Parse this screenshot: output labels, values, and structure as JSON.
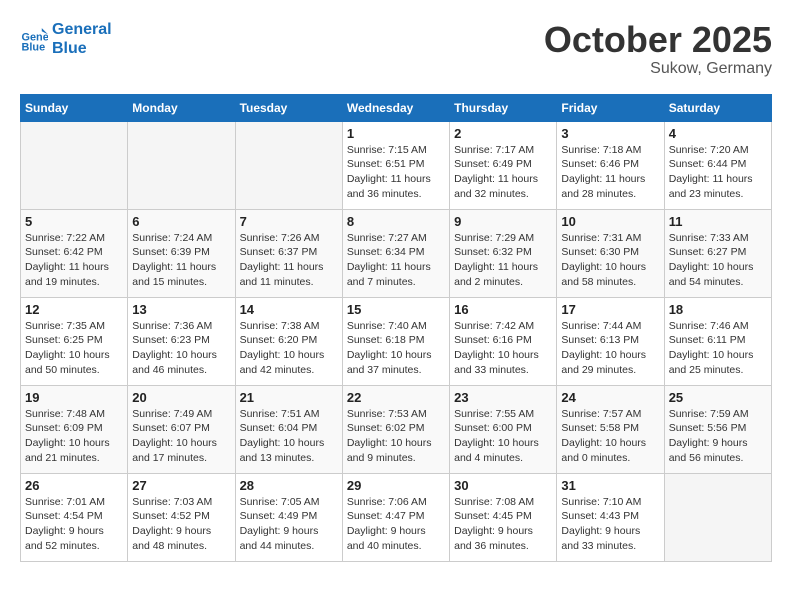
{
  "header": {
    "logo_line1": "General",
    "logo_line2": "Blue",
    "month": "October 2025",
    "location": "Sukow, Germany"
  },
  "weekdays": [
    "Sunday",
    "Monday",
    "Tuesday",
    "Wednesday",
    "Thursday",
    "Friday",
    "Saturday"
  ],
  "weeks": [
    [
      {
        "day": "",
        "info": ""
      },
      {
        "day": "",
        "info": ""
      },
      {
        "day": "",
        "info": ""
      },
      {
        "day": "1",
        "info": "Sunrise: 7:15 AM\nSunset: 6:51 PM\nDaylight: 11 hours\nand 36 minutes."
      },
      {
        "day": "2",
        "info": "Sunrise: 7:17 AM\nSunset: 6:49 PM\nDaylight: 11 hours\nand 32 minutes."
      },
      {
        "day": "3",
        "info": "Sunrise: 7:18 AM\nSunset: 6:46 PM\nDaylight: 11 hours\nand 28 minutes."
      },
      {
        "day": "4",
        "info": "Sunrise: 7:20 AM\nSunset: 6:44 PM\nDaylight: 11 hours\nand 23 minutes."
      }
    ],
    [
      {
        "day": "5",
        "info": "Sunrise: 7:22 AM\nSunset: 6:42 PM\nDaylight: 11 hours\nand 19 minutes."
      },
      {
        "day": "6",
        "info": "Sunrise: 7:24 AM\nSunset: 6:39 PM\nDaylight: 11 hours\nand 15 minutes."
      },
      {
        "day": "7",
        "info": "Sunrise: 7:26 AM\nSunset: 6:37 PM\nDaylight: 11 hours\nand 11 minutes."
      },
      {
        "day": "8",
        "info": "Sunrise: 7:27 AM\nSunset: 6:34 PM\nDaylight: 11 hours\nand 7 minutes."
      },
      {
        "day": "9",
        "info": "Sunrise: 7:29 AM\nSunset: 6:32 PM\nDaylight: 11 hours\nand 2 minutes."
      },
      {
        "day": "10",
        "info": "Sunrise: 7:31 AM\nSunset: 6:30 PM\nDaylight: 10 hours\nand 58 minutes."
      },
      {
        "day": "11",
        "info": "Sunrise: 7:33 AM\nSunset: 6:27 PM\nDaylight: 10 hours\nand 54 minutes."
      }
    ],
    [
      {
        "day": "12",
        "info": "Sunrise: 7:35 AM\nSunset: 6:25 PM\nDaylight: 10 hours\nand 50 minutes."
      },
      {
        "day": "13",
        "info": "Sunrise: 7:36 AM\nSunset: 6:23 PM\nDaylight: 10 hours\nand 46 minutes."
      },
      {
        "day": "14",
        "info": "Sunrise: 7:38 AM\nSunset: 6:20 PM\nDaylight: 10 hours\nand 42 minutes."
      },
      {
        "day": "15",
        "info": "Sunrise: 7:40 AM\nSunset: 6:18 PM\nDaylight: 10 hours\nand 37 minutes."
      },
      {
        "day": "16",
        "info": "Sunrise: 7:42 AM\nSunset: 6:16 PM\nDaylight: 10 hours\nand 33 minutes."
      },
      {
        "day": "17",
        "info": "Sunrise: 7:44 AM\nSunset: 6:13 PM\nDaylight: 10 hours\nand 29 minutes."
      },
      {
        "day": "18",
        "info": "Sunrise: 7:46 AM\nSunset: 6:11 PM\nDaylight: 10 hours\nand 25 minutes."
      }
    ],
    [
      {
        "day": "19",
        "info": "Sunrise: 7:48 AM\nSunset: 6:09 PM\nDaylight: 10 hours\nand 21 minutes."
      },
      {
        "day": "20",
        "info": "Sunrise: 7:49 AM\nSunset: 6:07 PM\nDaylight: 10 hours\nand 17 minutes."
      },
      {
        "day": "21",
        "info": "Sunrise: 7:51 AM\nSunset: 6:04 PM\nDaylight: 10 hours\nand 13 minutes."
      },
      {
        "day": "22",
        "info": "Sunrise: 7:53 AM\nSunset: 6:02 PM\nDaylight: 10 hours\nand 9 minutes."
      },
      {
        "day": "23",
        "info": "Sunrise: 7:55 AM\nSunset: 6:00 PM\nDaylight: 10 hours\nand 4 minutes."
      },
      {
        "day": "24",
        "info": "Sunrise: 7:57 AM\nSunset: 5:58 PM\nDaylight: 10 hours\nand 0 minutes."
      },
      {
        "day": "25",
        "info": "Sunrise: 7:59 AM\nSunset: 5:56 PM\nDaylight: 9 hours\nand 56 minutes."
      }
    ],
    [
      {
        "day": "26",
        "info": "Sunrise: 7:01 AM\nSunset: 4:54 PM\nDaylight: 9 hours\nand 52 minutes."
      },
      {
        "day": "27",
        "info": "Sunrise: 7:03 AM\nSunset: 4:52 PM\nDaylight: 9 hours\nand 48 minutes."
      },
      {
        "day": "28",
        "info": "Sunrise: 7:05 AM\nSunset: 4:49 PM\nDaylight: 9 hours\nand 44 minutes."
      },
      {
        "day": "29",
        "info": "Sunrise: 7:06 AM\nSunset: 4:47 PM\nDaylight: 9 hours\nand 40 minutes."
      },
      {
        "day": "30",
        "info": "Sunrise: 7:08 AM\nSunset: 4:45 PM\nDaylight: 9 hours\nand 36 minutes."
      },
      {
        "day": "31",
        "info": "Sunrise: 7:10 AM\nSunset: 4:43 PM\nDaylight: 9 hours\nand 33 minutes."
      },
      {
        "day": "",
        "info": ""
      }
    ]
  ]
}
